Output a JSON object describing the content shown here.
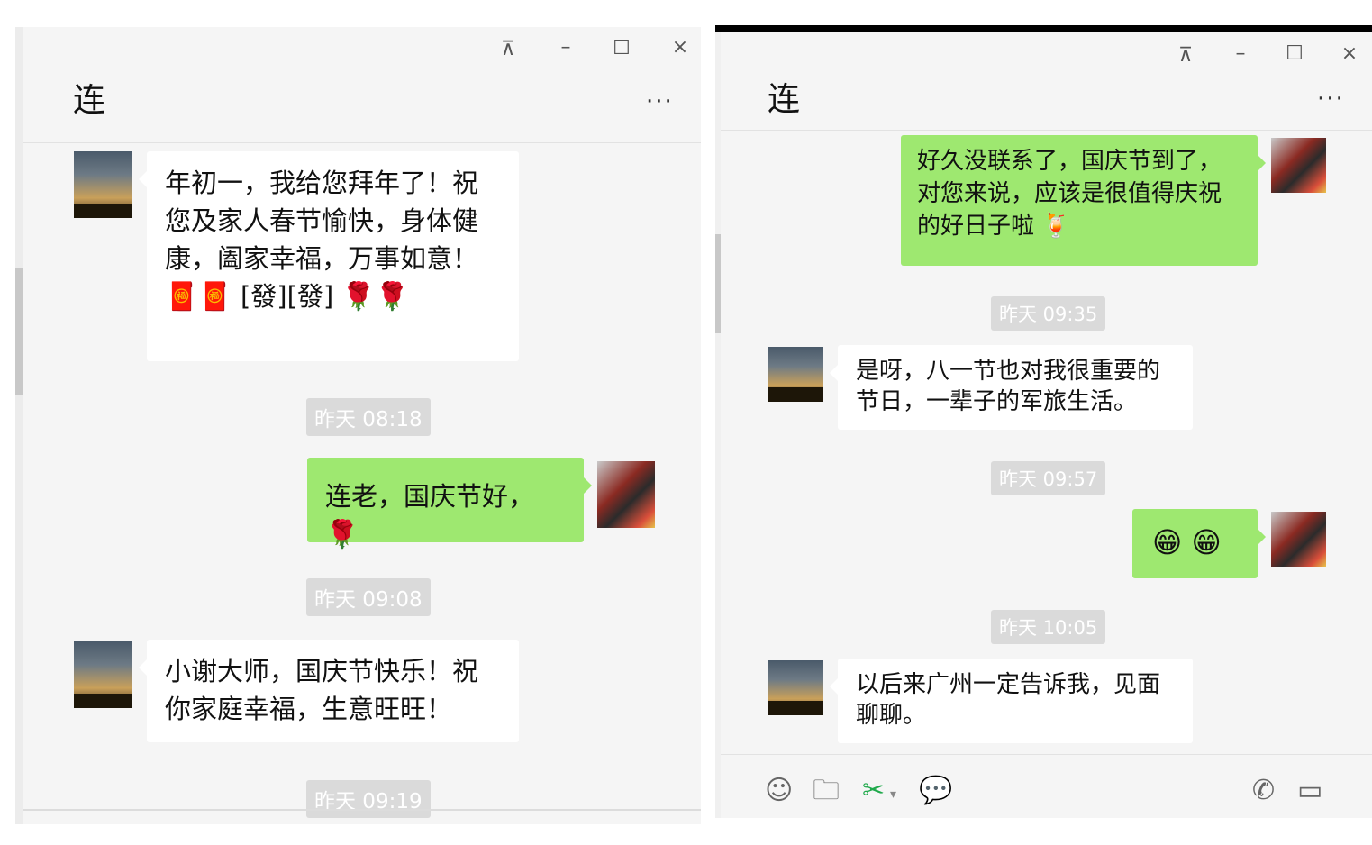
{
  "left": {
    "title": "连",
    "controls": {
      "pin": "⊼",
      "minimize": "–",
      "maximize": "☐",
      "close": "×"
    },
    "more": "···",
    "messages": [
      {
        "text": "年初一，我给您拜年了！祝您及家人春节愉快，身体健康，阖家幸福，万事如意！",
        "emoji": "🧧🧧",
        "tail": "[發][發]",
        "flowers": "🌹🌹"
      },
      {
        "timestamp": "昨天 08:18"
      },
      {
        "text": "连老，国庆节好，",
        "flowers": "🌹"
      },
      {
        "timestamp": "昨天 09:08"
      },
      {
        "text": "小谢大师，国庆节快乐！祝你家庭幸福，生意旺旺！"
      },
      {
        "timestamp": "昨天 09:19"
      }
    ]
  },
  "right": {
    "title": "连",
    "controls": {
      "pin": "⊼",
      "minimize": "–",
      "maximize": "☐",
      "close": "×"
    },
    "more": "···",
    "messages": [
      {
        "text": "好久没联系了，国庆节到了，对您来说，应该是很值得庆祝的好日子啦",
        "emoji": "🍹"
      },
      {
        "timestamp": "昨天 09:35"
      },
      {
        "text": "是呀，八一节也对我很重要的节日，一辈子的军旅生活。"
      },
      {
        "timestamp": "昨天 09:57"
      },
      {
        "emoji": "😁 😁"
      },
      {
        "timestamp": "昨天 10:05"
      },
      {
        "text": "以后来广州一定告诉我，见面聊聊。"
      }
    ],
    "toolbar": {
      "emoji": "☺",
      "file": "🗀",
      "screenshot": "✂",
      "chat": "💬",
      "phone": "✆",
      "video": "▭"
    }
  }
}
